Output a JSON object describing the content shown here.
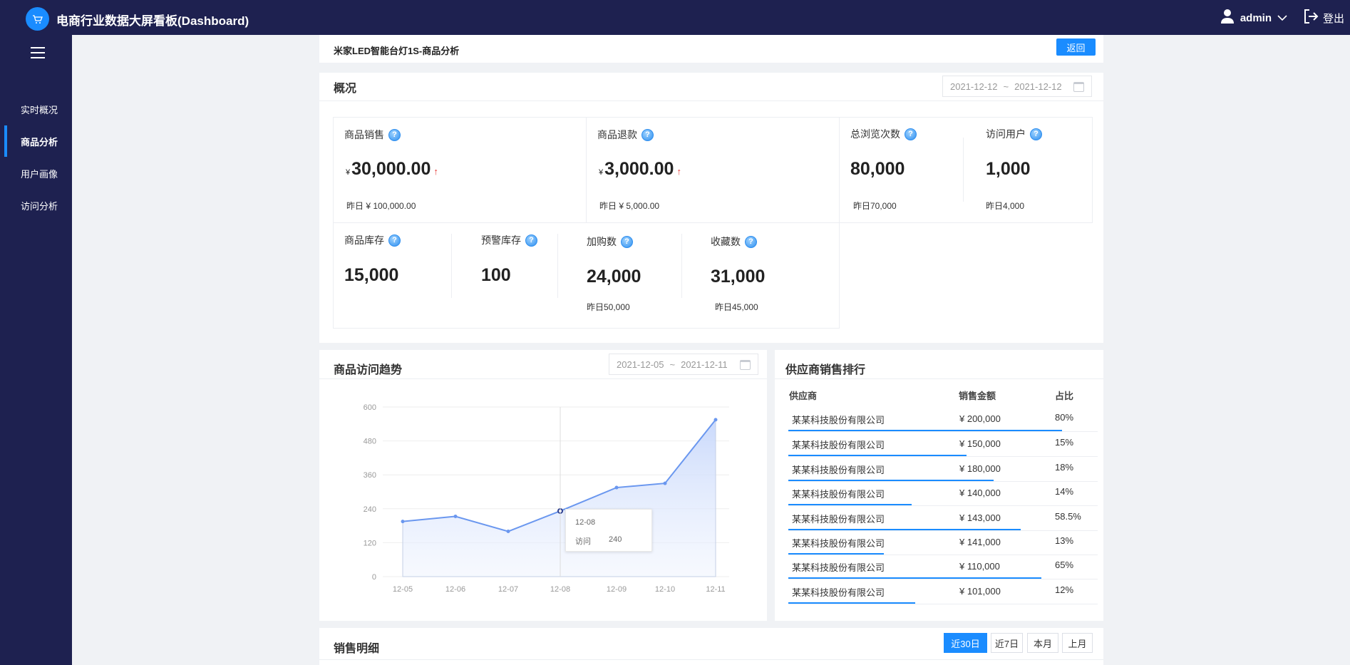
{
  "app": {
    "title": "电商行业数据大屏看板(Dashboard)",
    "user": "admin",
    "logout": "登出"
  },
  "sidebar": {
    "items": [
      {
        "label": "实时概况",
        "active": false
      },
      {
        "label": "商品分析",
        "active": true
      },
      {
        "label": "用户画像",
        "active": false
      },
      {
        "label": "访问分析",
        "active": false
      }
    ]
  },
  "header": {
    "product_title": "米家LED智能台灯1S-商品分析",
    "back_label": "返回"
  },
  "overview": {
    "title": "概况",
    "date_start": "2021-12-12",
    "date_sep": "~",
    "date_end": "2021-12-12",
    "sales": {
      "label": "商品销售",
      "currency": "¥",
      "value": "30,000.00",
      "trend": "↑",
      "prev": "昨日 ¥ 100,000.00"
    },
    "refund": {
      "label": "商品退款",
      "currency": "¥",
      "value": "3,000.00",
      "trend": "↑",
      "prev": "昨日 ¥ 5,000.00"
    },
    "views": {
      "label": "总浏览次数",
      "value": "80,000",
      "prev": "昨日70,000"
    },
    "visitors": {
      "label": "访问用户",
      "value": "1,000",
      "prev": "昨日4,000"
    },
    "stock": {
      "label": "商品库存",
      "value": "15,000"
    },
    "warn_stock": {
      "label": "预警库存",
      "value": "100"
    },
    "cart": {
      "label": "加购数",
      "value": "24,000",
      "prev": "昨日50,000"
    },
    "favorites": {
      "label": "收藏数",
      "value": "31,000",
      "prev": "昨日45,000"
    }
  },
  "trend": {
    "title": "商品访问趋势",
    "date_start": "2021-12-05",
    "date_sep": "~",
    "date_end": "2021-12-11",
    "tooltip": {
      "date": "12-08",
      "series": "访问",
      "value": "240"
    }
  },
  "chart_data": {
    "type": "area",
    "categories": [
      "12-05",
      "12-06",
      "12-07",
      "12-08",
      "12-09",
      "12-10",
      "12-11"
    ],
    "series": [
      {
        "name": "访问",
        "values": [
          195,
          213,
          160,
          232,
          315,
          330,
          555
        ]
      }
    ],
    "ylim": [
      0,
      600
    ],
    "yticks": [
      "0",
      "120",
      "240",
      "360",
      "480",
      "600"
    ],
    "grid": true,
    "colors": {
      "line": "#6a97ef",
      "fill": "#c8d8fb"
    }
  },
  "ranking": {
    "title": "供应商销售排行",
    "headers": [
      "供应商",
      "销售金额",
      "占比"
    ],
    "rows": [
      {
        "name": "某某科技股份有限公司",
        "amount": "¥ 200,000",
        "ratio": "80%",
        "bar": 0.8
      },
      {
        "name": "某某科技股份有限公司",
        "amount": "¥ 150,000",
        "ratio": "15%",
        "bar": 0.52
      },
      {
        "name": "某某科技股份有限公司",
        "amount": "¥ 180,000",
        "ratio": "18%",
        "bar": 0.6
      },
      {
        "name": "某某科技股份有限公司",
        "amount": "¥ 140,000",
        "ratio": "14%",
        "bar": 0.36
      },
      {
        "name": "某某科技股份有限公司",
        "amount": "¥ 143,000",
        "ratio": "58.5%",
        "bar": 0.68
      },
      {
        "name": "某某科技股份有限公司",
        "amount": "¥ 141,000",
        "ratio": "13%",
        "bar": 0.28
      },
      {
        "name": "某某科技股份有限公司",
        "amount": "¥ 110,000",
        "ratio": "65%",
        "bar": 0.74
      },
      {
        "name": "某某科技股份有限公司",
        "amount": "¥ 101,000",
        "ratio": "12%",
        "bar": 0.37
      }
    ]
  },
  "sales_detail": {
    "title": "销售明细",
    "tabs": [
      {
        "label": "近30日",
        "active": true
      },
      {
        "label": "近7日",
        "active": false
      },
      {
        "label": "本月",
        "active": false
      },
      {
        "label": "上月",
        "active": false
      }
    ]
  }
}
